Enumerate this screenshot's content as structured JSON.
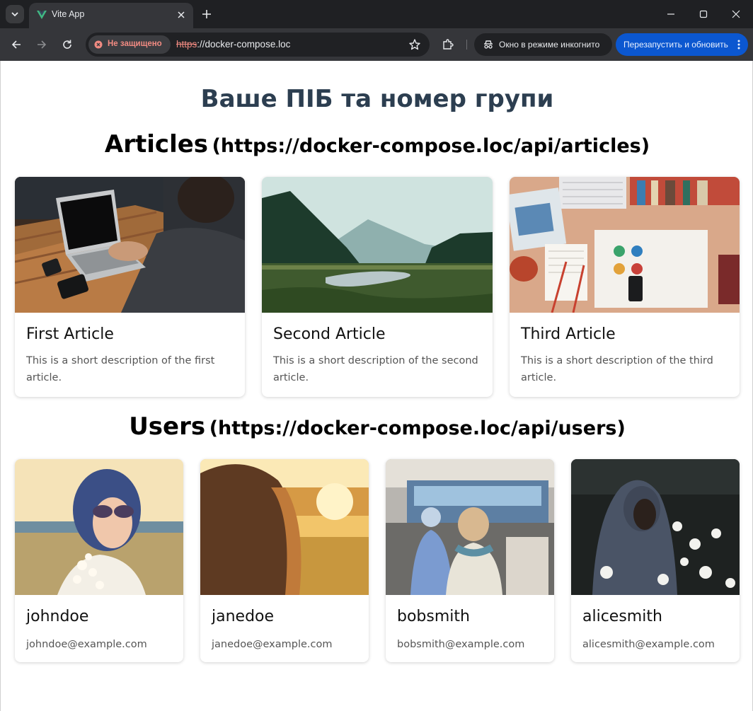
{
  "browser": {
    "tab_title": "Vite App",
    "security_label": "Не защищено",
    "url_scheme": "https",
    "url_rest": "://docker-compose.loc",
    "incognito_label": "Окно в режиме инкогнито",
    "relaunch_label": "Перезапустить и обновить",
    "accent_color": "#0b57d0"
  },
  "page": {
    "title": "Ваше ПІБ та номер групи",
    "articles_heading": "Articles",
    "articles_endpoint": "(https://docker-compose.loc/api/articles)",
    "users_heading": "Users",
    "users_endpoint": "(https://docker-compose.loc/api/users)"
  },
  "articles": [
    {
      "title": "First Article",
      "description": "This is a short description of the first article.",
      "image": "laptop-workspace-photo"
    },
    {
      "title": "Second Article",
      "description": "This is a short description of the second article.",
      "image": "river-valley-landscape-photo"
    },
    {
      "title": "Third Article",
      "description": "This is a short description of the third article.",
      "image": "desk-flatlay-photo"
    }
  ],
  "users": [
    {
      "username": "johndoe",
      "email": "johndoe@example.com",
      "image": "woman-sunglasses-flowers-photo"
    },
    {
      "username": "janedoe",
      "email": "janedoe@example.com",
      "image": "woman-sunset-field-photo"
    },
    {
      "username": "bobsmith",
      "email": "bobsmith@example.com",
      "image": "street-scooters-photo"
    },
    {
      "username": "alicesmith",
      "email": "alicesmith@example.com",
      "image": "hooded-person-daisies-photo"
    }
  ]
}
